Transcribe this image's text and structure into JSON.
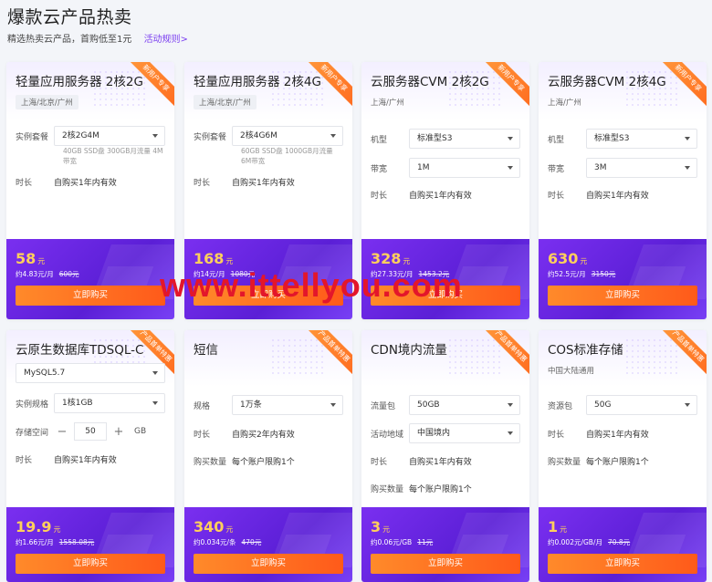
{
  "page": {
    "title": "爆款云产品热卖",
    "subtitle": "精选热卖云产品，首购低至1元",
    "rules_link": "活动规则>"
  },
  "watermark": "www.ittellyou.com",
  "colors": {
    "accent": "#7b3ff0",
    "price": "#ffcf5c",
    "buy": "#ff6a1e",
    "ribbon": "#ff7a24"
  },
  "cards": [
    {
      "title": "轻量应用服务器 2核2G",
      "region": "上海/北京/广州",
      "ribbon": "新用户专享",
      "set_label": "实例套餐",
      "set_value": "2核2G4M",
      "set_note": "40GB SSD盘 300GB月流量 4M带宽",
      "dur_label": "时长",
      "dur_value": "自购买1年内有效",
      "price": "58",
      "unit": "元",
      "price_sub": "约4.83元/月",
      "old": "600元",
      "buy": "立即购买"
    },
    {
      "title": "轻量应用服务器 2核4G",
      "region": "上海/北京/广州",
      "ribbon": "新用户专享",
      "set_label": "实例套餐",
      "set_value": "2核4G6M",
      "set_note": "60GB SSD盘 1000GB月流量 6M带宽",
      "dur_label": "时长",
      "dur_value": "自购买1年内有效",
      "price": "168",
      "unit": "元",
      "price_sub": "约14元/月",
      "old": "1080元",
      "buy": "立即购买"
    },
    {
      "title": "云服务器CVM 2核2G",
      "region": "上海/广州",
      "ribbon": "新用户专享",
      "type_label": "机型",
      "type_value": "标准型S3",
      "bw_label": "带宽",
      "bw_value": "1M",
      "dur_label": "时长",
      "dur_value": "自购买1年内有效",
      "price": "328",
      "unit": "元",
      "price_sub": "约27.33元/月",
      "old": "1453.2元",
      "buy": "立即购买"
    },
    {
      "title": "云服务器CVM 2核4G",
      "region": "上海/广州",
      "ribbon": "新用户专享",
      "type_label": "机型",
      "type_value": "标准型S3",
      "bw_label": "带宽",
      "bw_value": "3M",
      "dur_label": "时长",
      "dur_value": "自购买1年内有效",
      "price": "630",
      "unit": "元",
      "price_sub": "约52.5元/月",
      "old": "3150元",
      "buy": "立即购买"
    },
    {
      "title": "云原生数据库TDSQL-C",
      "ribbon": "产品首单特惠",
      "engine_value": "MySQL5.7",
      "spec_label": "实例规格",
      "spec_value": "1核1GB",
      "storage_label": "存储空间",
      "storage_value": "50",
      "storage_unit": "GB",
      "dur_label": "时长",
      "dur_value": "自购买1年内有效",
      "price": "19.9",
      "unit": "元",
      "price_sub": "约1.66元/月",
      "old": "1558.08元",
      "buy": "立即购买"
    },
    {
      "title": "短信",
      "ribbon": "产品首单特惠",
      "spec_label": "规格",
      "spec_value": "1万条",
      "dur_label": "时长",
      "dur_value": "自购买2年内有效",
      "qty_label": "购买数量",
      "qty_value": "每个账户限购1个",
      "price": "340",
      "unit": "元",
      "price_sub": "约0.034元/条",
      "old": "470元",
      "buy": "立即购买"
    },
    {
      "title": "CDN境内流量",
      "ribbon": "产品首单特惠",
      "pkg_label": "流量包",
      "pkg_value": "50GB",
      "area_label": "活动地域",
      "area_value": "中国境内",
      "dur_label": "时长",
      "dur_value": "自购买1年内有效",
      "qty_label": "购买数量",
      "qty_value": "每个账户限购1个",
      "price": "3",
      "unit": "元",
      "price_sub": "约0.06元/GB",
      "old": "11元",
      "buy": "立即购买"
    },
    {
      "title": "COS标准存储",
      "region": "中国大陆通用",
      "ribbon": "产品首单特惠",
      "pkg_label": "资源包",
      "pkg_value": "50G",
      "dur_label": "时长",
      "dur_value": "自购买1年内有效",
      "qty_label": "购买数量",
      "qty_value": "每个账户限购1个",
      "price": "1",
      "unit": "元",
      "price_sub": "约0.002元/GB/月",
      "old": "70.8元",
      "buy": "立即购买"
    }
  ]
}
